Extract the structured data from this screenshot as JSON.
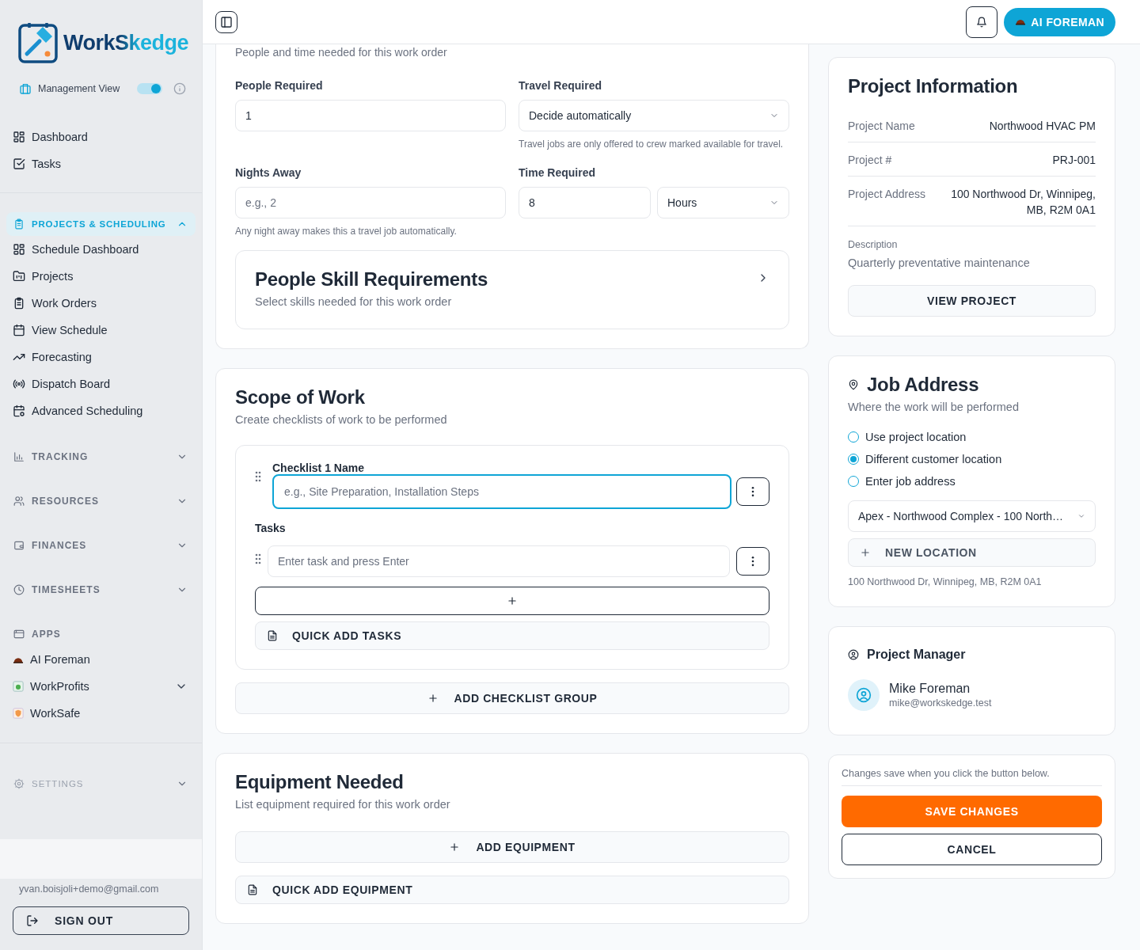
{
  "sidebar": {
    "brand": "WorkSkedge",
    "view_toggle": {
      "label": "Management View",
      "on": true
    },
    "top_items": [
      {
        "label": "Dashboard"
      },
      {
        "label": "Tasks"
      }
    ],
    "groups": [
      {
        "kind": "section",
        "label": "PROJECTS & SCHEDULING",
        "expanded": true,
        "selected": true,
        "items": [
          {
            "label": "Schedule Dashboard"
          },
          {
            "label": "Projects"
          },
          {
            "label": "Work Orders"
          },
          {
            "label": "View Schedule"
          },
          {
            "label": "Forecasting"
          },
          {
            "label": "Dispatch Board"
          },
          {
            "label": "Advanced Scheduling"
          }
        ]
      },
      {
        "kind": "section",
        "label": "TRACKING",
        "expanded": false,
        "selected": false
      },
      {
        "kind": "section",
        "label": "RESOURCES",
        "expanded": false,
        "selected": false
      },
      {
        "kind": "section",
        "label": "FINANCES",
        "expanded": false,
        "selected": false
      },
      {
        "kind": "section",
        "label": "TIMESHEETS",
        "expanded": false,
        "selected": false
      },
      {
        "kind": "apps",
        "label": "APPS",
        "items": [
          {
            "label": "AI Foreman"
          },
          {
            "label": "WorkProfits",
            "expanded": false
          },
          {
            "label": "WorkSafe"
          }
        ]
      }
    ],
    "settings": {
      "label": "SETTINGS",
      "expanded": false
    },
    "user_email": "yvan.boisjoli+demo@gmail.com",
    "sign_out": "SIGN OUT"
  },
  "header": {
    "ai_button": "AI FOREMAN"
  },
  "requirements": {
    "subtitle": "People and time needed for this work order",
    "people_required": {
      "label": "People Required",
      "value": "1"
    },
    "travel_required": {
      "label": "Travel Required",
      "value": "Decide automatically",
      "hint": "Travel jobs are only offered to crew marked available for travel."
    },
    "nights_away": {
      "label": "Nights Away",
      "placeholder": "e.g., 2",
      "hint": "Any night away makes this a travel job automatically."
    },
    "time_required": {
      "label": "Time Required",
      "value": "8",
      "unit": "Hours"
    },
    "skills": {
      "title": "People Skill Requirements",
      "subtitle": "Select skills needed for this work order"
    }
  },
  "scope": {
    "title": "Scope of Work",
    "subtitle": "Create checklists of work to be performed",
    "checklists": [
      {
        "label": "Checklist 1 Name",
        "placeholder": "e.g., Site Preparation, Installation Steps",
        "focused": true,
        "tasks_label": "Tasks",
        "tasks": [
          {
            "placeholder": "Enter task and press Enter"
          }
        ],
        "quick_add": "QUICK ADD TASKS"
      }
    ],
    "add_group": "ADD CHECKLIST GROUP"
  },
  "equipment": {
    "title": "Equipment Needed",
    "subtitle": "List equipment required for this work order",
    "add": "ADD EQUIPMENT",
    "quick_add": "QUICK ADD EQUIPMENT"
  },
  "project_info": {
    "title": "Project Information",
    "rows": [
      {
        "label": "Project Name",
        "value": "Northwood HVAC PM"
      },
      {
        "label": "Project #",
        "value": "PRJ-001"
      },
      {
        "label": "Project Address",
        "value": "100 Northwood Dr, Winnipeg, MB, R2M 0A1"
      }
    ],
    "description_label": "Description",
    "description": "Quarterly preventative maintenance",
    "button": "VIEW PROJECT"
  },
  "job_address": {
    "title": "Job Address",
    "subtitle": "Where the work will be performed",
    "options": [
      {
        "label": "Use project location",
        "selected": false
      },
      {
        "label": "Different customer location",
        "selected": true
      },
      {
        "label": "Enter job address",
        "selected": false
      }
    ],
    "location": "Apex - Northwood Complex - 100 North…",
    "new_location": "NEW LOCATION",
    "address": "100 Northwood Dr, Winnipeg, MB, R2M 0A1"
  },
  "project_manager": {
    "title": "Project Manager",
    "name": "Mike Foreman",
    "email": "mike@workskedge.test"
  },
  "save_panel": {
    "note": "Changes save when you click the button below.",
    "save": "SAVE CHANGES",
    "cancel": "CANCEL"
  }
}
